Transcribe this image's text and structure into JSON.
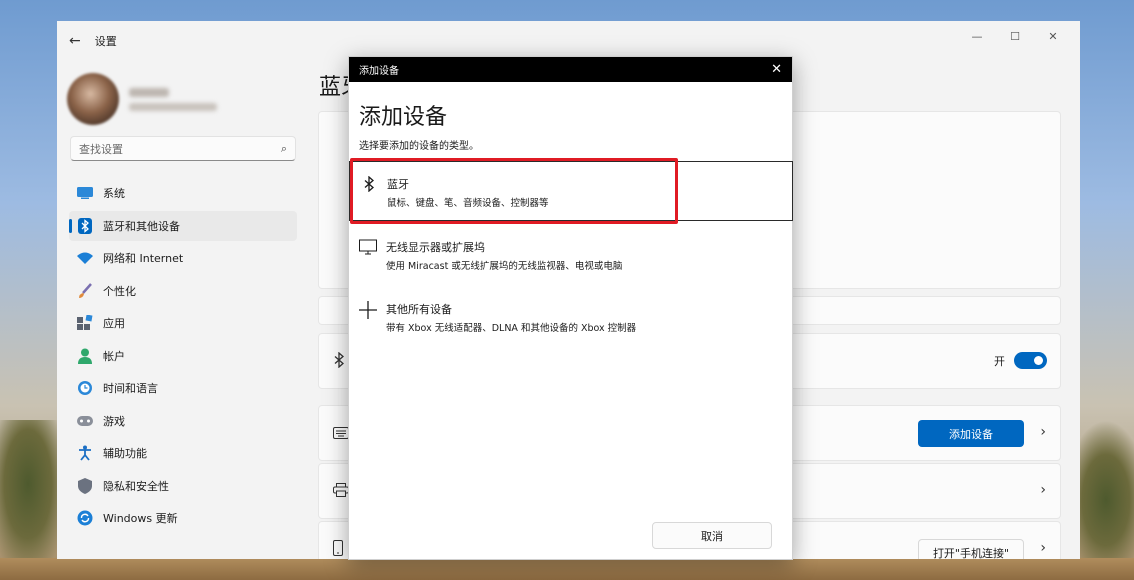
{
  "window": {
    "app_title": "设置",
    "controls": [
      "minimize",
      "maximize",
      "close"
    ]
  },
  "search": {
    "placeholder": "查找设置"
  },
  "sidebar": {
    "items": [
      {
        "label": "系统",
        "icon": "system-icon"
      },
      {
        "label": "蓝牙和其他设备",
        "icon": "bluetooth-icon",
        "active": true
      },
      {
        "label": "网络和 Internet",
        "icon": "wifi-icon"
      },
      {
        "label": "个性化",
        "icon": "brush-icon"
      },
      {
        "label": "应用",
        "icon": "apps-icon"
      },
      {
        "label": "帐户",
        "icon": "account-icon"
      },
      {
        "label": "时间和语言",
        "icon": "globe-clock-icon"
      },
      {
        "label": "游戏",
        "icon": "gamepad-icon"
      },
      {
        "label": "辅助功能",
        "icon": "accessibility-icon"
      },
      {
        "label": "隐私和安全性",
        "icon": "shield-icon"
      },
      {
        "label": "Windows 更新",
        "icon": "update-icon"
      }
    ]
  },
  "main": {
    "title": "蓝牙",
    "bluetooth_toggle_label": "开",
    "bluetooth_on": true,
    "add_device_button": "添加设备",
    "phone_button": "打开\"手机连接\""
  },
  "dialog": {
    "titlebar": "添加设备",
    "heading": "添加设备",
    "subtitle": "选择要添加的设备的类型。",
    "options": [
      {
        "title": "蓝牙",
        "desc": "鼠标、键盘、笔、音频设备、控制器等",
        "icon": "bluetooth-icon"
      },
      {
        "title": "无线显示器或扩展坞",
        "desc": "使用 Miracast 或无线扩展坞的无线监视器、电视或电脑",
        "icon": "monitor-icon"
      },
      {
        "title": "其他所有设备",
        "desc": "带有 Xbox 无线适配器、DLNA 和其他设备的 Xbox 控制器",
        "icon": "plus-icon"
      }
    ],
    "cancel_button": "取消"
  },
  "colors": {
    "accent": "#0067c0",
    "highlight": "#e01b24"
  }
}
